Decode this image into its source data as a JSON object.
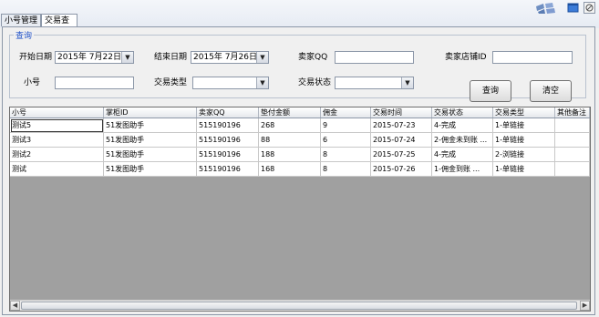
{
  "tabs": [
    {
      "label": "小号管理"
    },
    {
      "label": "交易查询"
    }
  ],
  "query": {
    "group_title": "查询",
    "start_date_label": "开始日期",
    "start_date_value": "2015年 7月22日",
    "end_date_label": "结束日期",
    "end_date_value": "2015年 7月26日",
    "seller_qq_label": "卖家QQ",
    "seller_qq_value": "",
    "shop_id_label": "卖家店铺ID",
    "shop_id_value": "",
    "account_label": "小号",
    "account_value": "",
    "trade_type_label": "交易类型",
    "trade_type_value": "",
    "trade_status_label": "交易状态",
    "trade_status_value": "",
    "search_button": "查询",
    "clear_button": "清空"
  },
  "table": {
    "columns": [
      "小号",
      "掌柜ID",
      "卖家QQ",
      "垫付金额",
      "佣金",
      "交易时间",
      "交易状态",
      "交易类型",
      "其他备注"
    ],
    "rows": [
      [
        "测试5",
        "51发图助手",
        "515190196",
        "268",
        "9",
        "2015-07-23",
        "4-完成",
        "1-单链接",
        ""
      ],
      [
        "测试3",
        "51发图助手",
        "515190196",
        "88",
        "6",
        "2015-07-24",
        "2-佣金未到账 ...",
        "1-单链接",
        ""
      ],
      [
        "测试2",
        "51发图助手",
        "515190196",
        "188",
        "8",
        "2015-07-25",
        "4-完成",
        "2-浏链接",
        ""
      ],
      [
        "测试",
        "51发图助手",
        "515190196",
        "168",
        "8",
        "2015-07-26",
        "1-佣金到账 ...",
        "1-单链接",
        ""
      ]
    ]
  },
  "icons": {
    "logo": "windows-logo-icon",
    "window": "window-icon",
    "close": "close-icon"
  }
}
